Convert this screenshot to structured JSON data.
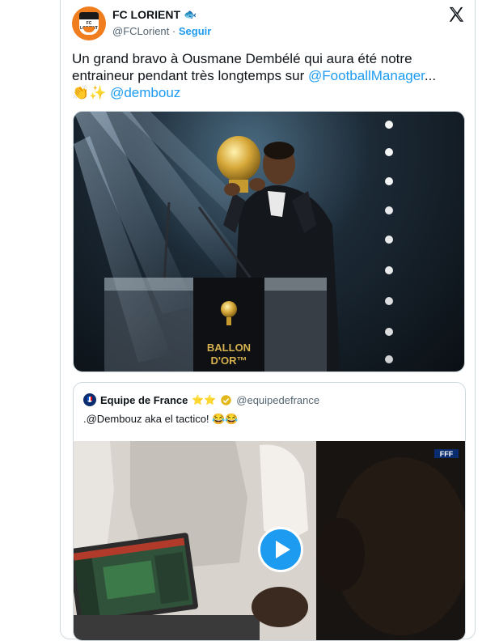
{
  "tweet": {
    "author_name": "FC LORIENT",
    "author_handle": "@FCLorient",
    "separator": "·",
    "follow_label": "Seguir",
    "text_part1": "Un grand bravo à Ousmane Dembélé qui aura été notre entraineur pendant très longtemps sur ",
    "mention1": "@FootballManager",
    "ellipsis": "...",
    "emojis": "👏✨",
    "mention2": "@dembouz",
    "avatar_crest_text": "FC LORIENT"
  },
  "media_image": {
    "podium_text_line1": "BALLON",
    "podium_text_line2": "D'OR™"
  },
  "quote": {
    "author_name": "Equipe de France",
    "stars": "⭐⭐",
    "author_handle": "@equipedefrance",
    "text": ".@Dembouz aka el tactico! 😂😂",
    "video_badge": "FFF"
  },
  "colors": {
    "accent": "#1d9bf0",
    "brand_orange": "#f07d1e",
    "text": "#0f1419",
    "muted": "#536471",
    "border": "#cfd9de"
  },
  "icons": {
    "logo": "x-logo",
    "verified": "verified-badge-icon",
    "play": "play-icon",
    "fish": "fish-emoji-icon"
  }
}
